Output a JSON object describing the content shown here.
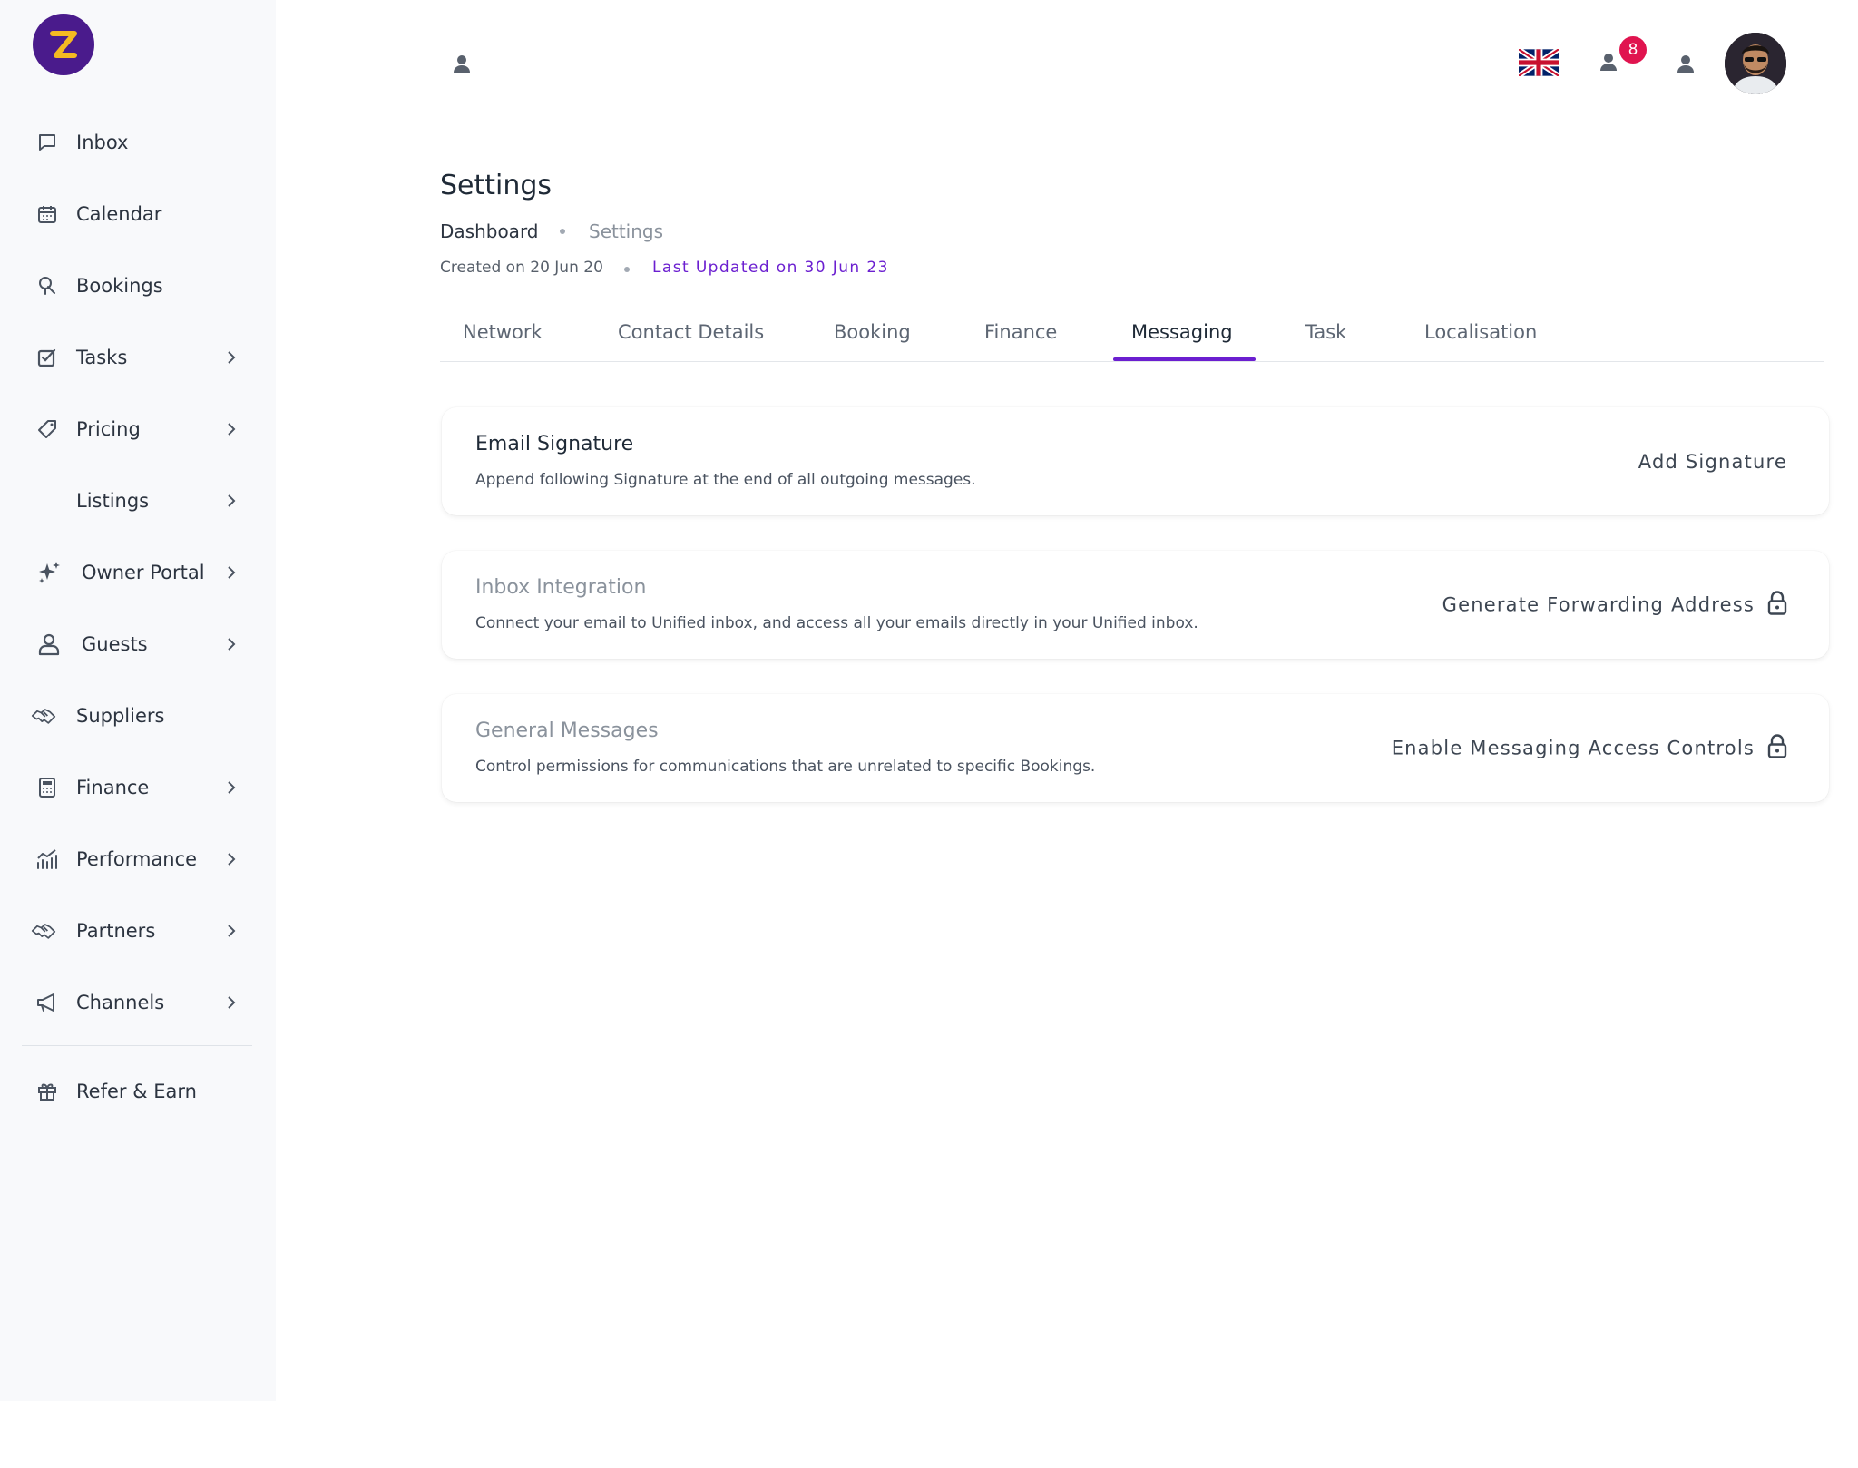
{
  "sidebar": {
    "items": [
      {
        "label": "Inbox",
        "icon": "inbox-icon",
        "has_chevron": false
      },
      {
        "label": "Calendar",
        "icon": "calendar-icon",
        "has_chevron": false
      },
      {
        "label": "Bookings",
        "icon": "bookings-icon",
        "has_chevron": false
      },
      {
        "label": "Tasks",
        "icon": "tasks-icon",
        "has_chevron": true
      },
      {
        "label": "Pricing",
        "icon": "tag-icon",
        "has_chevron": true
      },
      {
        "label": "Listings",
        "icon": "",
        "has_chevron": true
      },
      {
        "label": "Owner Portal",
        "icon": "sparkles-icon",
        "has_chevron": true
      },
      {
        "label": "Guests",
        "icon": "guests-icon",
        "has_chevron": true
      },
      {
        "label": "Suppliers",
        "icon": "handshake-icon",
        "has_chevron": false
      },
      {
        "label": "Finance",
        "icon": "calculator-icon",
        "has_chevron": true
      },
      {
        "label": "Performance",
        "icon": "chart-icon",
        "has_chevron": true
      },
      {
        "label": "Partners",
        "icon": "handshake-icon",
        "has_chevron": true
      },
      {
        "label": "Channels",
        "icon": "megaphone-icon",
        "has_chevron": true
      }
    ],
    "footer_item": {
      "label": "Refer & Earn",
      "icon": "gift-icon"
    }
  },
  "header": {
    "notification_count": "8"
  },
  "page": {
    "title": "Settings",
    "breadcrumb": [
      "Dashboard",
      "Settings"
    ],
    "created": "Created on 20 Jun 20",
    "updated": "Last Updated on 30 Jun 23"
  },
  "tabs": [
    "Network",
    "Contact Details",
    "Booking",
    "Finance",
    "Messaging",
    "Task",
    "Localisation"
  ],
  "active_tab": "Messaging",
  "cards": [
    {
      "title": "Email Signature",
      "description": "Append following Signature at the end of all outgoing messages.",
      "action": "Add Signature",
      "locked": false
    },
    {
      "title": "Inbox Integration",
      "description": "Connect your email to Unified inbox, and access all your emails directly in your Unified inbox.",
      "action": "Generate Forwarding Address",
      "locked": true
    },
    {
      "title": "General Messages",
      "description": "Control permissions for communications that are unrelated to specific Bookings.",
      "action": "Enable Messaging Access Controls",
      "locked": true
    }
  ],
  "colors": {
    "accent": "#6b1fd0",
    "badge": "#e0144f",
    "logo_bg": "#4a1b8c",
    "logo_fg": "#f5b921"
  }
}
